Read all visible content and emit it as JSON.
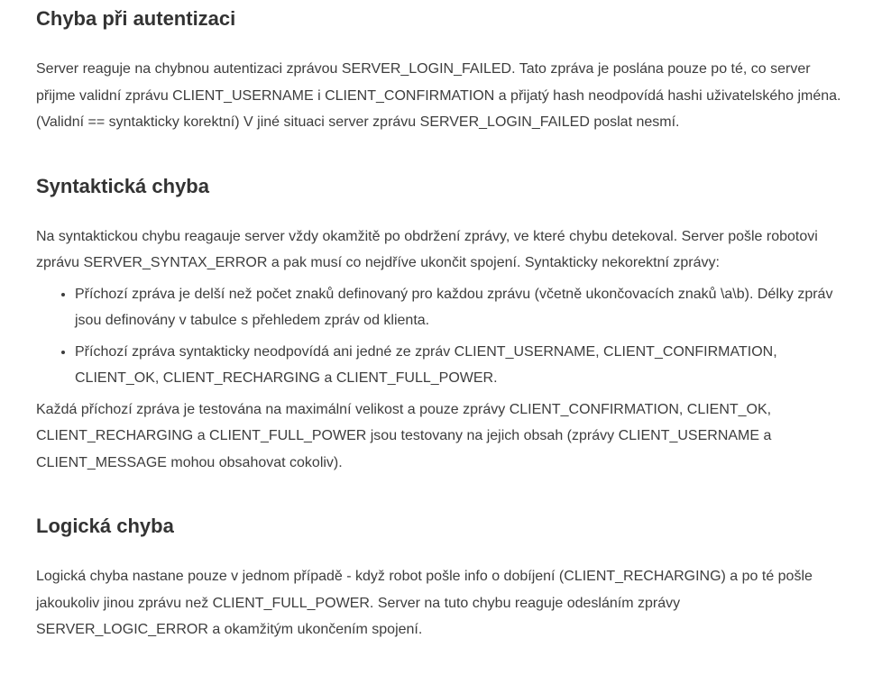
{
  "sections": {
    "auth": {
      "heading": "Chyba při autentizaci",
      "paragraph": "Server reaguje na chybnou autentizaci zprávou SERVER_LOGIN_FAILED. Tato zpráva je poslána pouze po té, co server přijme validní zprávu CLIENT_USERNAME i CLIENT_CONFIRMATION a přijatý hash neodpovídá hashi uživatelského jména. (Validní == syntakticky korektní) V jiné situaci server zprávu SERVER_LOGIN_FAILED poslat nesmí."
    },
    "syntax": {
      "heading": "Syntaktická chyba",
      "paragraph": "Na syntaktickou chybu reagauje server vždy okamžitě po obdržení zprávy, ve které chybu detekoval. Server pošle robotovi zprávu SERVER_SYNTAX_ERROR a pak musí co nejdříve ukončit spojení. Syntakticky nekorektní zprávy:",
      "bullets": [
        "Příchozí zpráva je delší než počet znaků definovaný pro každou zprávu (včetně ukončovacích znaků \\a\\b). Délky zpráv jsou definovány v tabulce s přehledem zpráv od klienta.",
        "Příchozí zpráva syntakticky neodpovídá ani jedné ze zpráv CLIENT_USERNAME, CLIENT_CONFIRMATION, CLIENT_OK, CLIENT_RECHARGING a CLIENT_FULL_POWER."
      ],
      "paragraph2": "Každá příchozí zpráva je testována na maximální velikost a pouze zprávy CLIENT_CONFIRMATION, CLIENT_OK, CLIENT_RECHARGING a CLIENT_FULL_POWER jsou testovany na jejich obsah (zprávy CLIENT_USERNAME a CLIENT_MESSAGE mohou obsahovat cokoliv)."
    },
    "logic": {
      "heading": "Logická chyba",
      "paragraph": "Logická chyba nastane pouze v jednom případě - když robot pošle info o dobíjení (CLIENT_RECHARGING) a po té pošle jakoukoliv jinou zprávu než CLIENT_FULL_POWER. Server na tuto chybu reaguje odesláním zprávy SERVER_LOGIC_ERROR a okamžitým ukončením spojení."
    }
  }
}
